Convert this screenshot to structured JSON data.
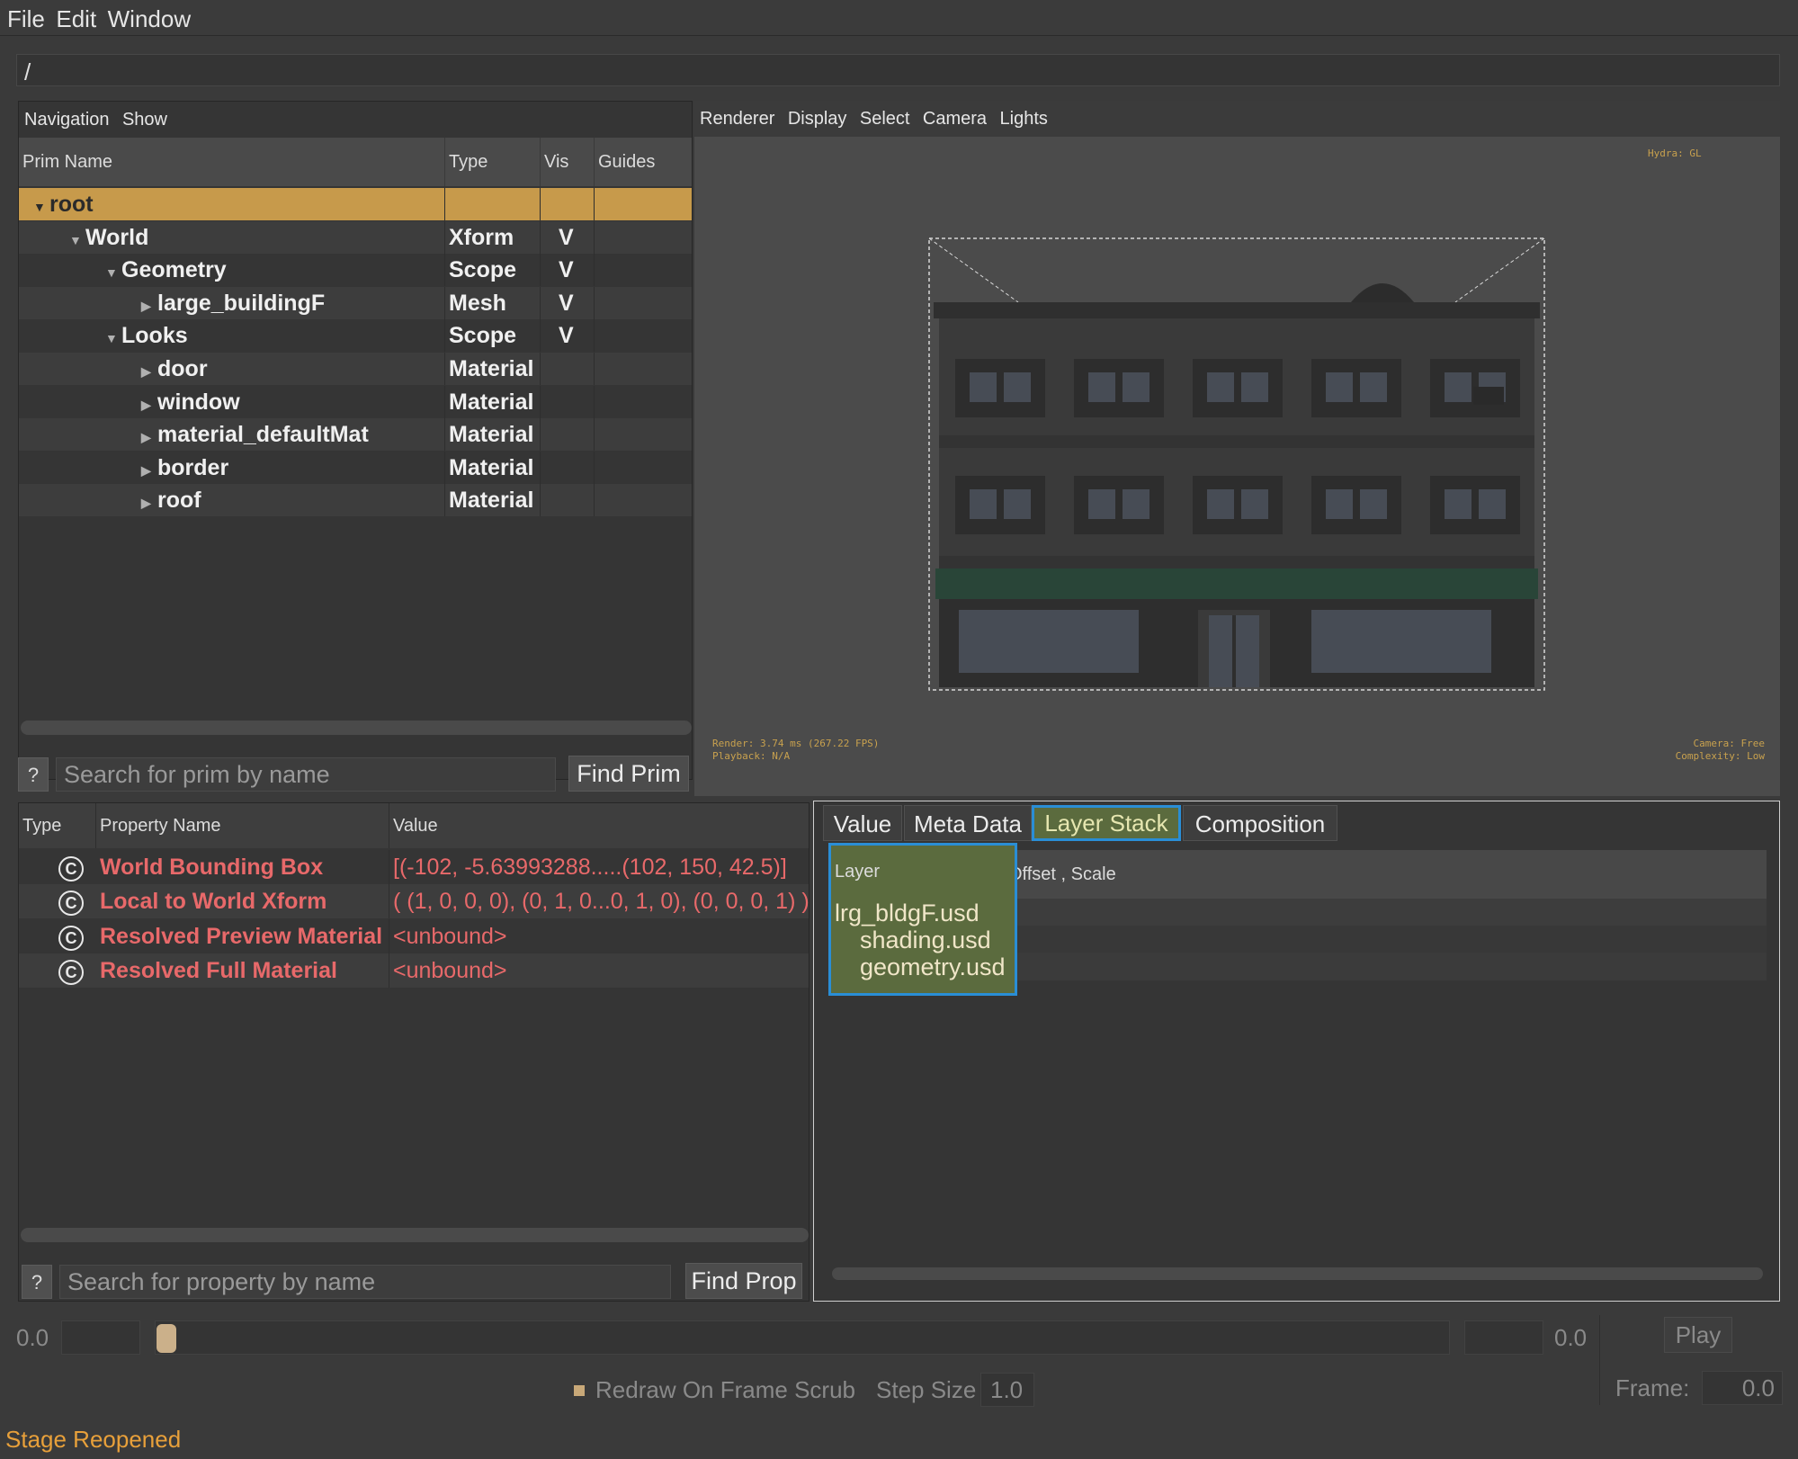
{
  "menu": [
    "File",
    "Edit",
    "Window"
  ],
  "path": "/",
  "left_panel": {
    "menu": [
      "Navigation",
      "Show"
    ],
    "columns": [
      "Prim Name",
      "Type",
      "Vis",
      "Guides"
    ],
    "rows": [
      {
        "name": "root",
        "type": "",
        "vis": "",
        "arrow": "▼"
      },
      {
        "name": "World",
        "type": "Xform",
        "vis": "V",
        "arrow": "▼"
      },
      {
        "name": "Geometry",
        "type": "Scope",
        "vis": "V",
        "arrow": "▼"
      },
      {
        "name": "large_buildingF",
        "type": "Mesh",
        "vis": "V",
        "arrow": "▶"
      },
      {
        "name": "Looks",
        "type": "Scope",
        "vis": "V",
        "arrow": "▼"
      },
      {
        "name": "door",
        "type": "Material",
        "vis": "",
        "arrow": "▶"
      },
      {
        "name": "window",
        "type": "Material",
        "vis": "",
        "arrow": "▶"
      },
      {
        "name": "material_defaultMat",
        "type": "Material",
        "vis": "",
        "arrow": "▶"
      },
      {
        "name": "border",
        "type": "Material",
        "vis": "",
        "arrow": "▶"
      },
      {
        "name": "roof",
        "type": "Material",
        "vis": "",
        "arrow": "▶"
      }
    ],
    "help": "?",
    "search_placeholder": "Search for prim by name",
    "find_button": "Find Prim"
  },
  "viewport": {
    "menu": [
      "Renderer",
      "Display",
      "Select",
      "Camera",
      "Lights"
    ],
    "hud_top_right": "Hydra: GL",
    "hud_bottom_left_1": "Render: 3.74 ms (267.22 FPS)",
    "hud_bottom_left_2": "Playback: N/A",
    "hud_bottom_right_1": "Camera: Free",
    "hud_bottom_right_2": "Complexity: Low"
  },
  "properties": {
    "columns": [
      "Type",
      "Property Name",
      "Value"
    ],
    "rows": [
      {
        "icon": "C",
        "name": "World Bounding Box",
        "value": "[(-102, -5.63993288.....(102, 150, 42.5)]"
      },
      {
        "icon": "C",
        "name": "Local to World Xform",
        "value": "( (1, 0, 0, 0), (0, 1, 0...0, 1, 0), (0, 0, 0, 1) )"
      },
      {
        "icon": "C",
        "name": "Resolved Preview Material",
        "value": "<unbound>"
      },
      {
        "icon": "C",
        "name": "Resolved Full Material",
        "value": "<unbound>"
      }
    ],
    "help": "?",
    "search_placeholder": "Search for property by name",
    "find_button": "Find Prop"
  },
  "tabs": {
    "items": [
      "Value",
      "Meta Data",
      "Layer Stack",
      "Composition"
    ],
    "active": "Layer Stack",
    "layer_columns": [
      "Layer",
      "Offset , Scale"
    ],
    "layers": [
      "lrg_bldgF.usd",
      "shading.usd",
      "geometry.usd"
    ]
  },
  "timeline": {
    "start": "0.0",
    "end": "0.0",
    "play_button": "Play",
    "redraw_label": "Redraw On Frame Scrub",
    "step_size_label": "Step Size",
    "step_size_value": "1.0",
    "frame_label": "Frame:",
    "frame_value": "0.0"
  },
  "status": "Stage Reopened",
  "colors": {
    "selection": "#c79a4b",
    "property_text": "#e8696a",
    "status_text": "#e8a03a",
    "active_tab": "#5b6b3e",
    "highlight_border": "#2a8ed6"
  }
}
